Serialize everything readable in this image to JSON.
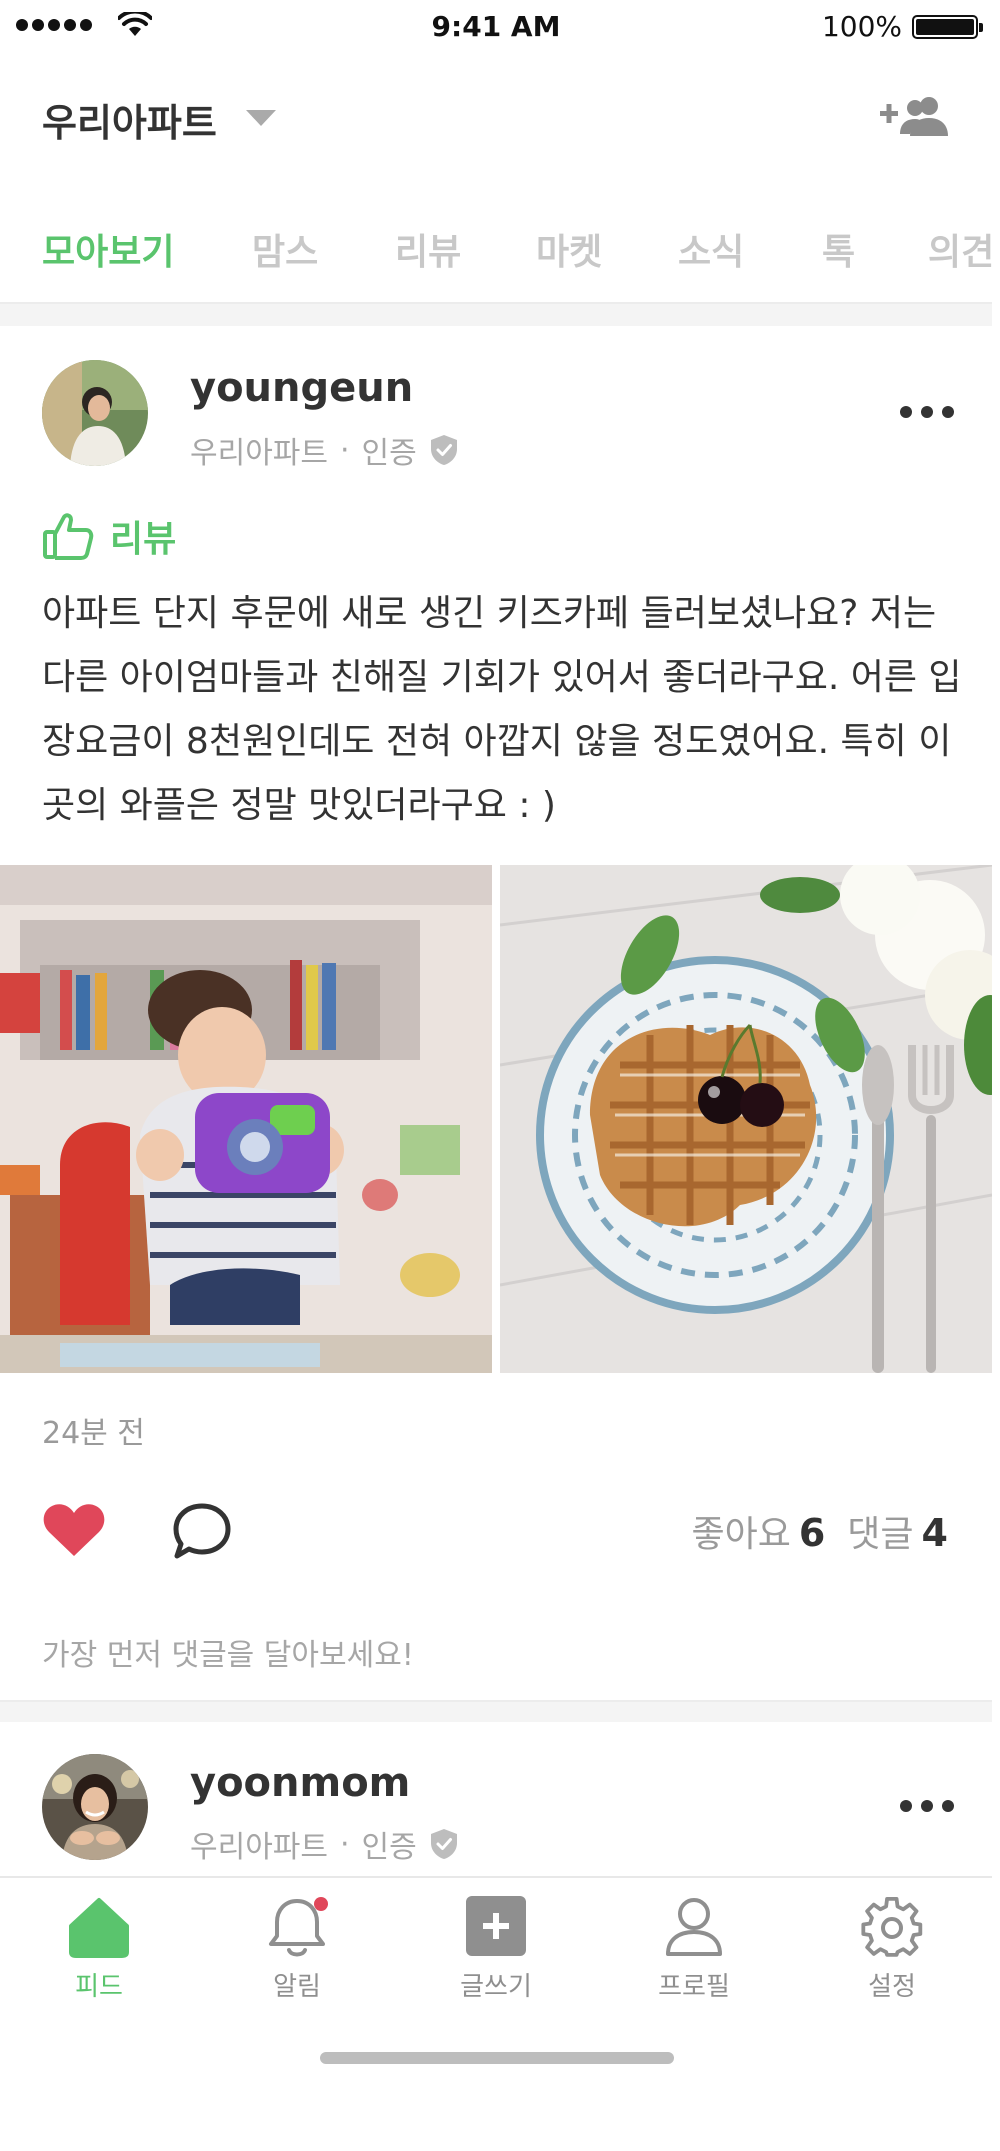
{
  "status_bar": {
    "time": "9:41 AM",
    "battery": "100%"
  },
  "header": {
    "title": "우리아파트"
  },
  "tabs": [
    {
      "label": "모아보기",
      "active": true
    },
    {
      "label": "맘스"
    },
    {
      "label": "리뷰"
    },
    {
      "label": "마켓"
    },
    {
      "label": "소식"
    },
    {
      "label": "톡"
    },
    {
      "label": "의견"
    }
  ],
  "posts": [
    {
      "username": "youngeun",
      "community": "우리아파트",
      "separator": "·",
      "badge": "인증",
      "category": "리뷰",
      "text": "아파트 단지 후문에 새로 생긴 키즈카페 들러보셨나요? 저는 다른 아이엄마들과 친해질 기회가 있어서 좋더라구요. 어른 입장요금이 8천원인데도 전혀 아깝지 않을 정도였어요. 특히 이곳의 와플은 정말 맛있더라구요 : )",
      "time_ago": "24분 전",
      "likes_label": "좋아요",
      "likes_count": "6",
      "comments_label": "댓글",
      "comments_count": "4",
      "comment_prompt": "가장 먼저 댓글을 달아보세요!"
    },
    {
      "username": "yoonmom",
      "community": "우리아파트",
      "separator": "·",
      "badge": "인증"
    }
  ],
  "bottom_nav": [
    {
      "label": "피드",
      "icon": "home-icon",
      "active": true
    },
    {
      "label": "알림",
      "icon": "bell-icon",
      "has_notification": true
    },
    {
      "label": "글쓰기",
      "icon": "write-icon"
    },
    {
      "label": "프로필",
      "icon": "profile-icon"
    },
    {
      "label": "설정",
      "icon": "settings-icon"
    }
  ],
  "colors": {
    "accent": "#5ac46d",
    "like": "#e0475a",
    "text": "#333333",
    "muted": "#a6a6a6",
    "notification": "#e0475a"
  }
}
